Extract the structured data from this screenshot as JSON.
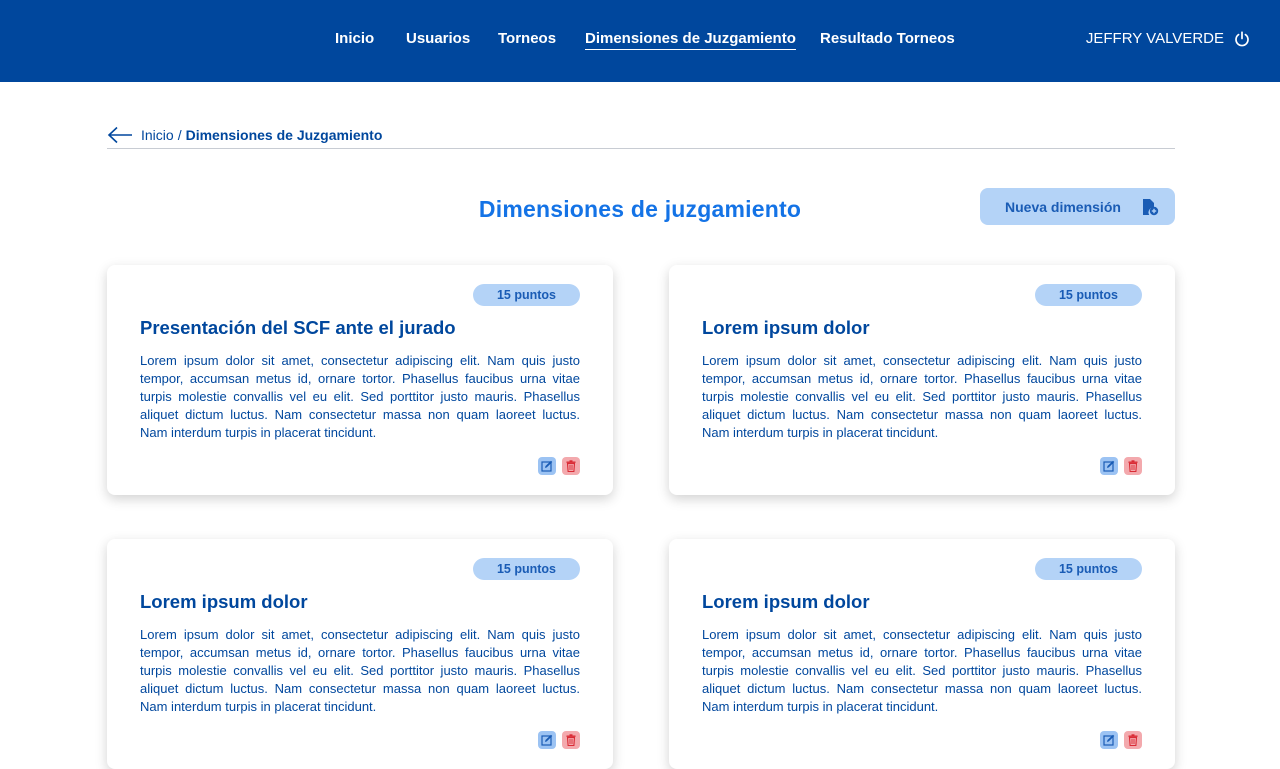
{
  "nav": {
    "items": [
      {
        "label": "Inicio"
      },
      {
        "label": "Usuarios"
      },
      {
        "label": "Torneos"
      },
      {
        "label": "Dimensiones de Juzgamiento",
        "active": true
      },
      {
        "label": "Resultado Torneos"
      }
    ],
    "user_name": "JEFFRY VALVERDE",
    "logout_icon": "power-icon"
  },
  "breadcrumb": {
    "back_icon": "arrow-left-icon",
    "home": "Inicio",
    "separator": "/",
    "current": "Dimensiones de Juzgamiento"
  },
  "page": {
    "title": "Dimensiones de juzgamiento",
    "new_button": "Nueva dimensión",
    "new_button_icon": "file-add-icon"
  },
  "cards": [
    {
      "points": "15 puntos",
      "title": "Presentación del SCF ante el jurado",
      "description": "Lorem ipsum dolor sit amet, consectetur adipiscing elit. Nam quis justo  tempor, accumsan metus id, ornare tortor. Phasellus faucibus urna vitae  turpis molestie convallis vel eu elit. Sed porttitor justo mauris.  Phasellus aliquet dictum luctus. Nam consectetur massa non quam laoreet  luctus. Nam interdum turpis in placerat tincidunt."
    },
    {
      "points": "15 puntos",
      "title": "Lorem ipsum dolor",
      "description": "Lorem ipsum dolor sit amet, consectetur adipiscing elit. Nam quis justo  tempor, accumsan metus id, ornare tortor. Phasellus faucibus urna vitae  turpis molestie convallis vel eu elit. Sed porttitor justo mauris.  Phasellus aliquet dictum luctus. Nam consectetur massa non quam laoreet  luctus. Nam interdum turpis in placerat tincidunt."
    },
    {
      "points": "15 puntos",
      "title": "Lorem ipsum dolor",
      "description": "Lorem ipsum dolor sit amet, consectetur adipiscing elit. Nam quis justo  tempor, accumsan metus id, ornare tortor. Phasellus faucibus urna vitae  turpis molestie convallis vel eu elit. Sed porttitor justo mauris.  Phasellus aliquet dictum luctus. Nam consectetur massa non quam laoreet  luctus. Nam interdum turpis in placerat tincidunt."
    },
    {
      "points": "15 puntos",
      "title": "Lorem ipsum dolor",
      "description": "Lorem ipsum dolor sit amet, consectetur adipiscing elit. Nam quis justo  tempor, accumsan metus id, ornare tortor. Phasellus faucibus urna vitae  turpis molestie convallis vel eu elit. Sed porttitor justo mauris.  Phasellus aliquet dictum luctus. Nam consectetur massa non quam laoreet  luctus. Nam interdum turpis in placerat tincidunt."
    }
  ],
  "colors": {
    "navbar": "#00479d",
    "accent": "#1473e6",
    "badge_bg": "#b4d3f7",
    "edit_bg": "#9cc3f3",
    "delete_bg": "#f3a9ad"
  }
}
